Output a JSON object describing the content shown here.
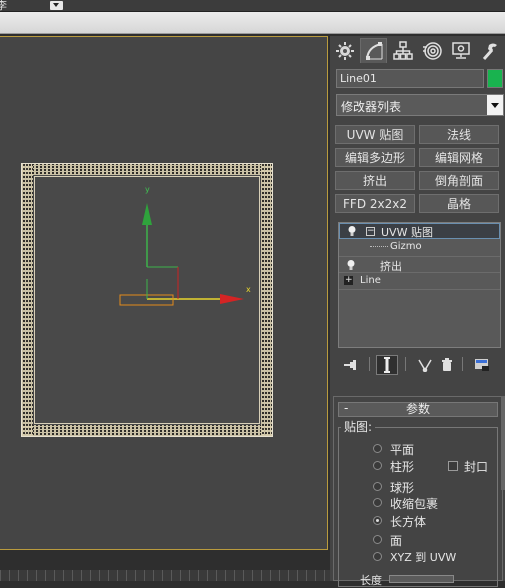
{
  "topbar": {
    "menu_text": "李"
  },
  "viewport": {
    "axes": {
      "x": "x",
      "y": "y"
    }
  },
  "panel": {
    "tabs": [
      "create",
      "modify",
      "hierarchy",
      "motion",
      "display",
      "utilities"
    ],
    "object_name": "Line01",
    "object_color": "#19b34f",
    "modifier_list": "修改器列表",
    "buttons": [
      "UVW 贴图",
      "法线",
      "编辑多边形",
      "编辑网格",
      "挤出",
      "倒角剖面",
      "FFD 2x2x2",
      "晶格"
    ],
    "stack": [
      {
        "label": "UVW 贴图",
        "selected": true
      },
      {
        "label": "Gizmo",
        "selected": false
      },
      {
        "label": "挤出",
        "selected": false
      },
      {
        "label": "Line",
        "selected": false
      }
    ],
    "rollout": {
      "minus": "-",
      "title": "参数",
      "group_label": "贴图:",
      "options": [
        "平面",
        "柱形",
        "球形",
        "收缩包裹",
        "长方体",
        "面",
        "XYZ 到 UVW"
      ],
      "selected_option": "长方体",
      "cap_label": "封口",
      "length_label": "长度"
    }
  }
}
